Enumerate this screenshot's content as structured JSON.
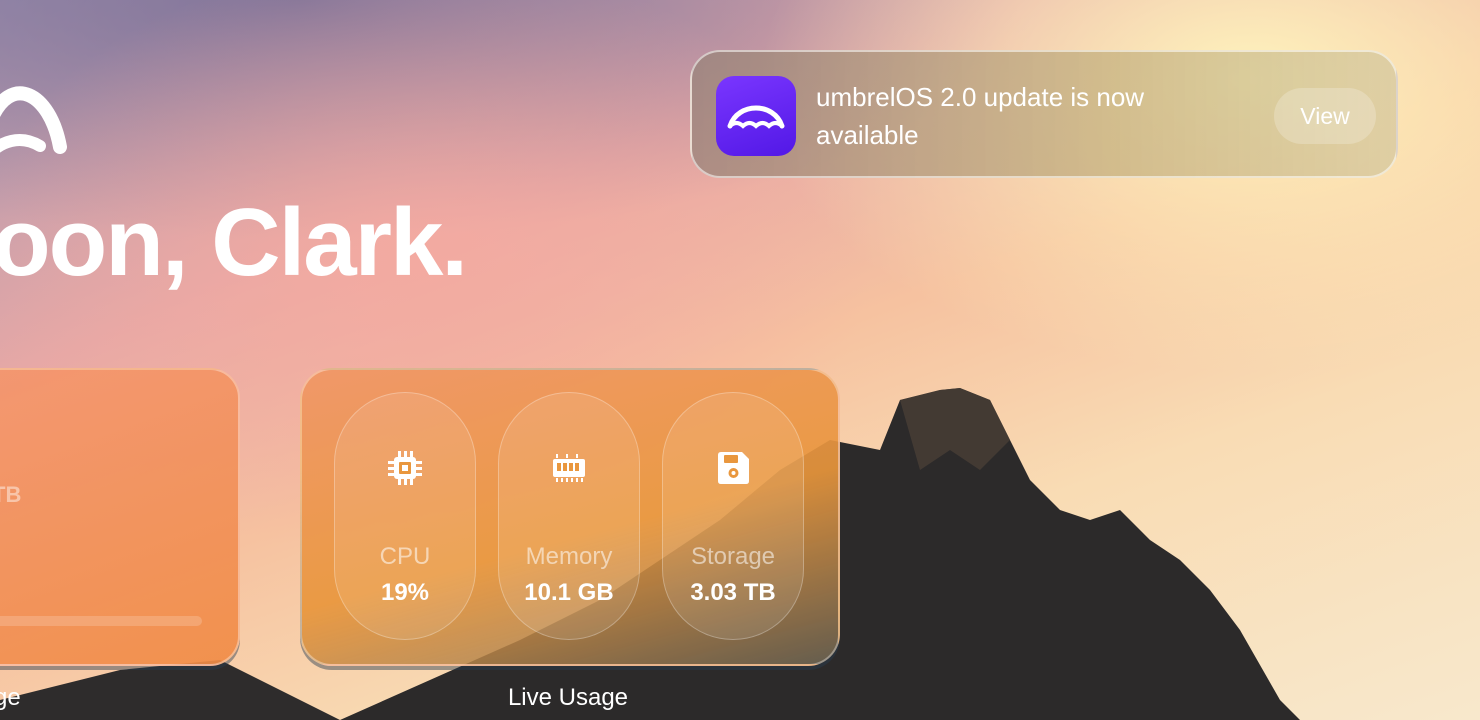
{
  "greeting": "oon, Clark.",
  "storage_widget": {
    "value_partial": "TB",
    "caption": "ge"
  },
  "live_usage": {
    "caption": "Live Usage",
    "metrics": [
      {
        "icon": "cpu-chip-icon",
        "label": "CPU",
        "value": "19%"
      },
      {
        "icon": "memory-ram-icon",
        "label": "Memory",
        "value": "10.1 GB"
      },
      {
        "icon": "floppy-disk-icon",
        "label": "Storage",
        "value": "3.03 TB"
      }
    ]
  },
  "notification": {
    "icon": "umbrel-app-icon",
    "message": "umbrelOS 2.0 update is now available",
    "action_label": "View"
  },
  "colors": {
    "notification_icon": "#6a2af5",
    "text": "#ffffff"
  }
}
